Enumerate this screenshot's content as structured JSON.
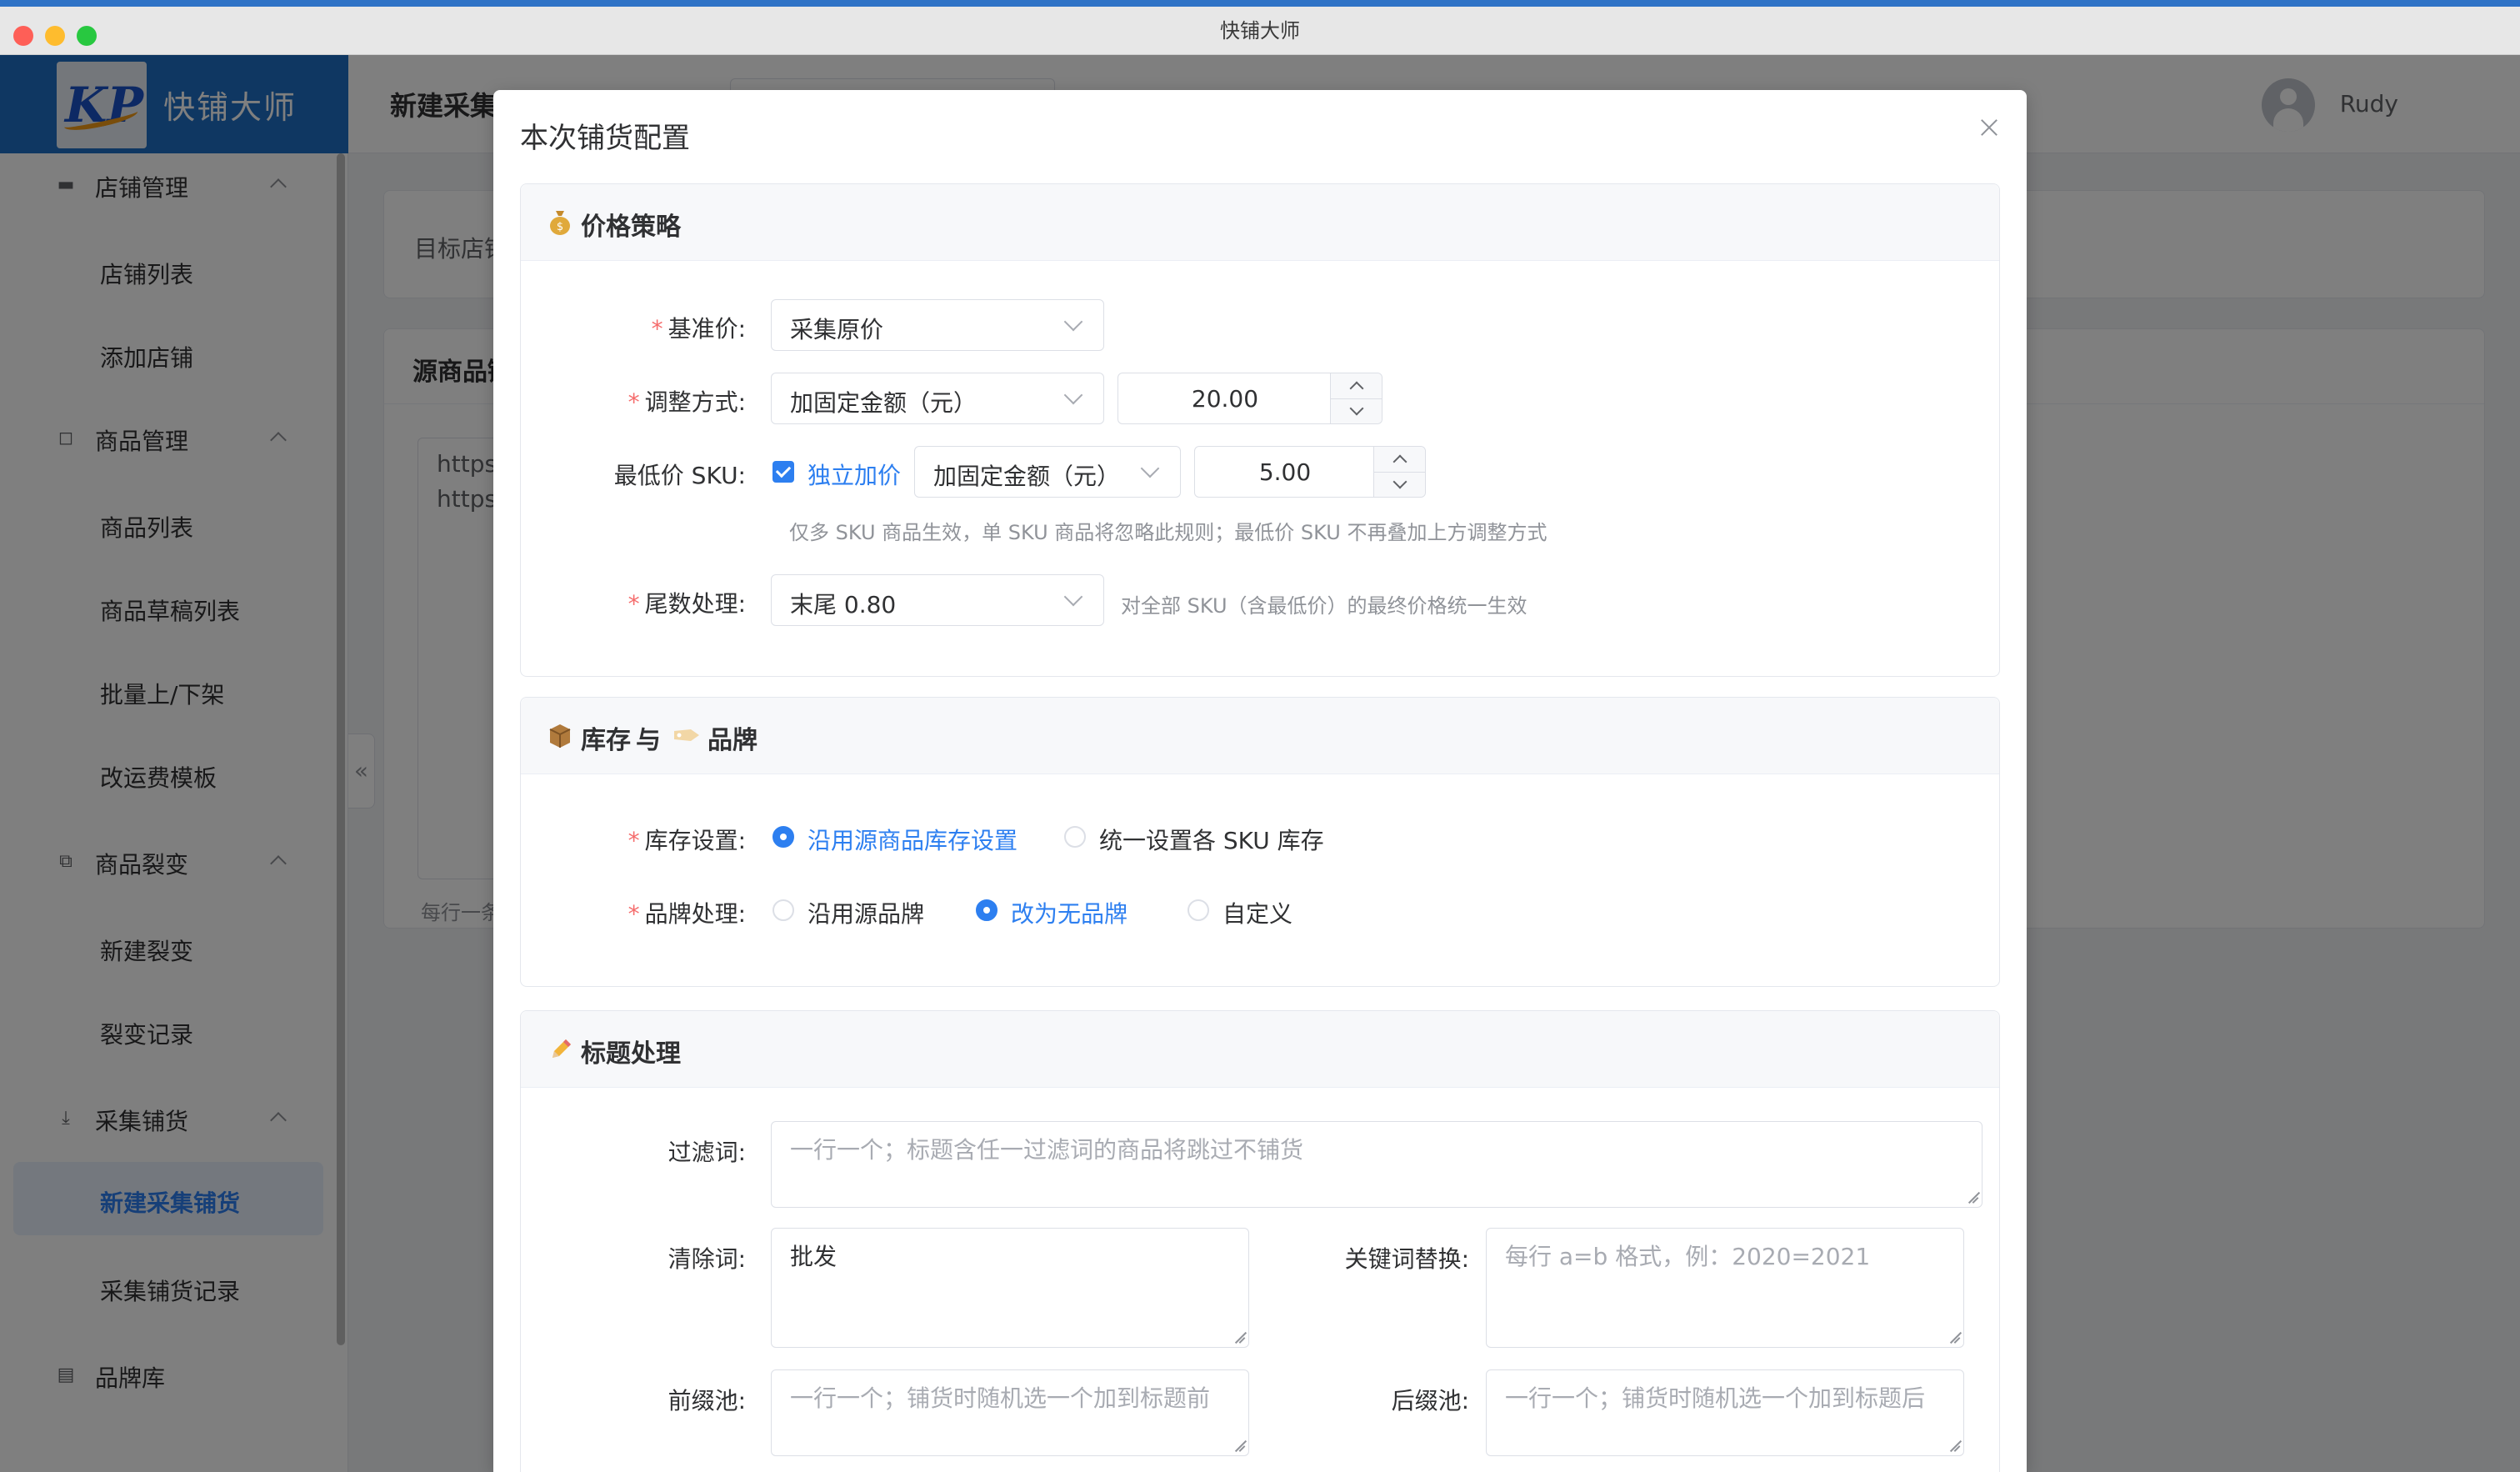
{
  "window": {
    "title": "快铺大师"
  },
  "brand": {
    "name": "快铺大师",
    "logo_text": "KP"
  },
  "sidebar": {
    "groups": [
      {
        "label": "店铺管理",
        "icon": "store-icon",
        "items": [
          "店铺列表",
          "添加店铺"
        ]
      },
      {
        "label": "商品管理",
        "icon": "bag-icon",
        "items": [
          "商品列表",
          "商品草稿列表",
          "批量上/下架",
          "改运费模板"
        ]
      },
      {
        "label": "商品裂变",
        "icon": "copy-icon",
        "items": [
          "新建裂变",
          "裂变记录"
        ]
      },
      {
        "label": "采集铺货",
        "icon": "download-icon",
        "items": [
          "新建采集铺货",
          "采集铺货记录"
        ]
      },
      {
        "label": "品牌库",
        "icon": "book-icon",
        "items": []
      }
    ],
    "active_item": "新建采集铺货"
  },
  "header": {
    "page_title": "新建采集",
    "user": "Rudy"
  },
  "background": {
    "target_shop_label": "目标店铺",
    "source_card_title": "源商品链接",
    "url_lines": [
      "https",
      "https"
    ],
    "hint": "每行一条"
  },
  "dialog": {
    "title": "本次铺货配置",
    "price": {
      "title": "价格策略",
      "icon": "money-bag-icon",
      "base_label": "基准价:",
      "base_value": "采集原价",
      "adjust_label": "调整方式:",
      "adjust_mode": "加固定金额（元）",
      "adjust_amount": "20.00",
      "min_sku_label": "最低价 SKU:",
      "min_sku_checkbox": "独立加价",
      "min_sku_mode": "加固定金额（元）",
      "min_sku_amount": "5.00",
      "min_sku_hint": "仅多 SKU 商品生效，单 SKU 商品将忽略此规则；最低价 SKU 不再叠加上方调整方式",
      "tail_label": "尾数处理:",
      "tail_value": "末尾 0.80",
      "tail_hint": "对全部 SKU（含最低价）的最终价格统一生效"
    },
    "stock": {
      "title_a": "库存",
      "title_mid": "与",
      "title_b": "品牌",
      "icon_a": "package-icon",
      "icon_b": "tag-icon",
      "stock_label": "库存设置:",
      "stock_options": [
        "沿用源商品库存设置",
        "统一设置各 SKU 库存"
      ],
      "stock_selected": 0,
      "brand_label": "品牌处理:",
      "brand_options": [
        "沿用源品牌",
        "改为无品牌",
        "自定义"
      ],
      "brand_selected": 1
    },
    "titles": {
      "title": "标题处理",
      "icon": "pencil-icon",
      "filter_label": "过滤词:",
      "filter_placeholder": "一行一个；标题含任一过滤词的商品将跳过不铺货",
      "clear_label": "清除词:",
      "clear_value": "批发",
      "replace_label": "关键词替换:",
      "replace_placeholder": "每行 a=b 格式，例：2020=2021",
      "prefix_label": "前缀池:",
      "prefix_placeholder": "一行一个；铺货时随机选一个加到标题前",
      "suffix_label": "后缀池:",
      "suffix_placeholder": "一行一个；铺货时随机选一个加到标题后"
    }
  }
}
